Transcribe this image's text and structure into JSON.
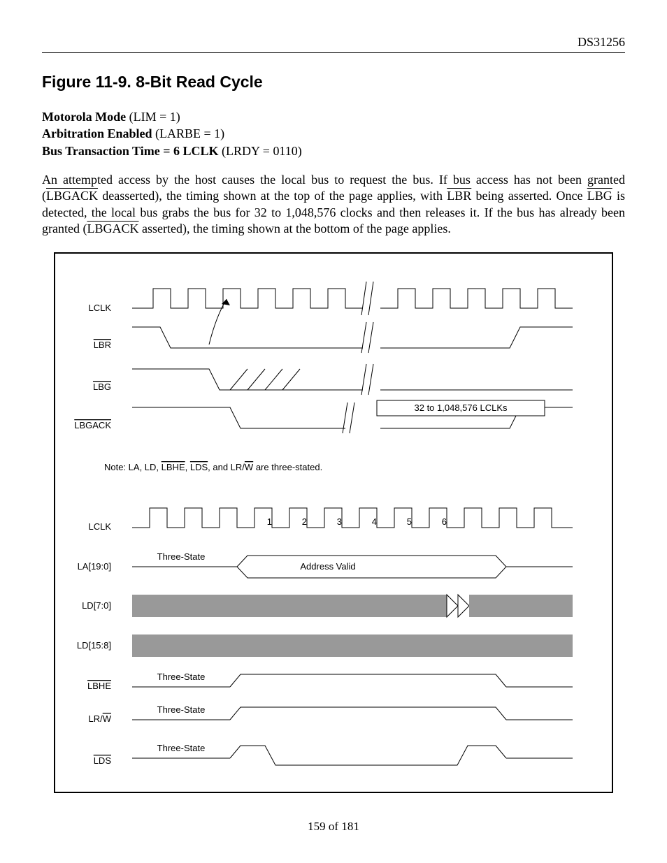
{
  "doc_id": "DS31256",
  "figure": {
    "number": "Figure 11-9.",
    "title": "8-Bit Read Cycle"
  },
  "modes": {
    "line1_bold": "Motorola Mode",
    "line1_rest": " (LIM = 1)",
    "line2_bold": "Arbitration Enabled",
    "line2_rest": " (LARBE = 1)",
    "line3_bold": "Bus Transaction Time = 6 LCLK",
    "line3_rest": " (LRDY = 0110)"
  },
  "paragraph": {
    "p1": "An attempted access by the host causes the local bus to request the bus. If bus access has not been granted (",
    "s1": "LBGACK",
    "p2": " deasserted), the timing shown at the top of the page applies, with ",
    "s2": "LBR",
    "p3": " being asserted. Once ",
    "s3": "LBG",
    "p4": " is detected, the local bus grabs the bus for 32 to 1,048,576 clocks and then releases it. If the bus has already been granted (",
    "s4": "LBGACK",
    "p5": " asserted), the timing shown at the bottom of the page applies."
  },
  "signals_top": {
    "lclk": "LCLK",
    "lbr": "LBR",
    "lbg": "LBG",
    "lbgack": "LBGACK",
    "note_pre": "Note: LA, LD, ",
    "note_s1": "LBHE",
    "note_mid1": ", ",
    "note_s2": "LDS",
    "note_mid2": ", and LR/",
    "note_s3": "W",
    "note_post": " are three-stated.",
    "lclk_range": "32 to 1,048,576 LCLKs"
  },
  "signals_bot": {
    "lclk": "LCLK",
    "la": "LA[19:0]",
    "ld_lo": "LD[7:0]",
    "ld_hi": "LD[15:8]",
    "lbhe": "LBHE",
    "lrw_pre": "LR/",
    "lrw_w": "W",
    "lds": "LDS",
    "three_state": "Three-State",
    "addr_valid": "Address Valid",
    "cycle_nums": [
      "1",
      "2",
      "3",
      "4",
      "5",
      "6"
    ]
  },
  "page_number": "159 of 181"
}
